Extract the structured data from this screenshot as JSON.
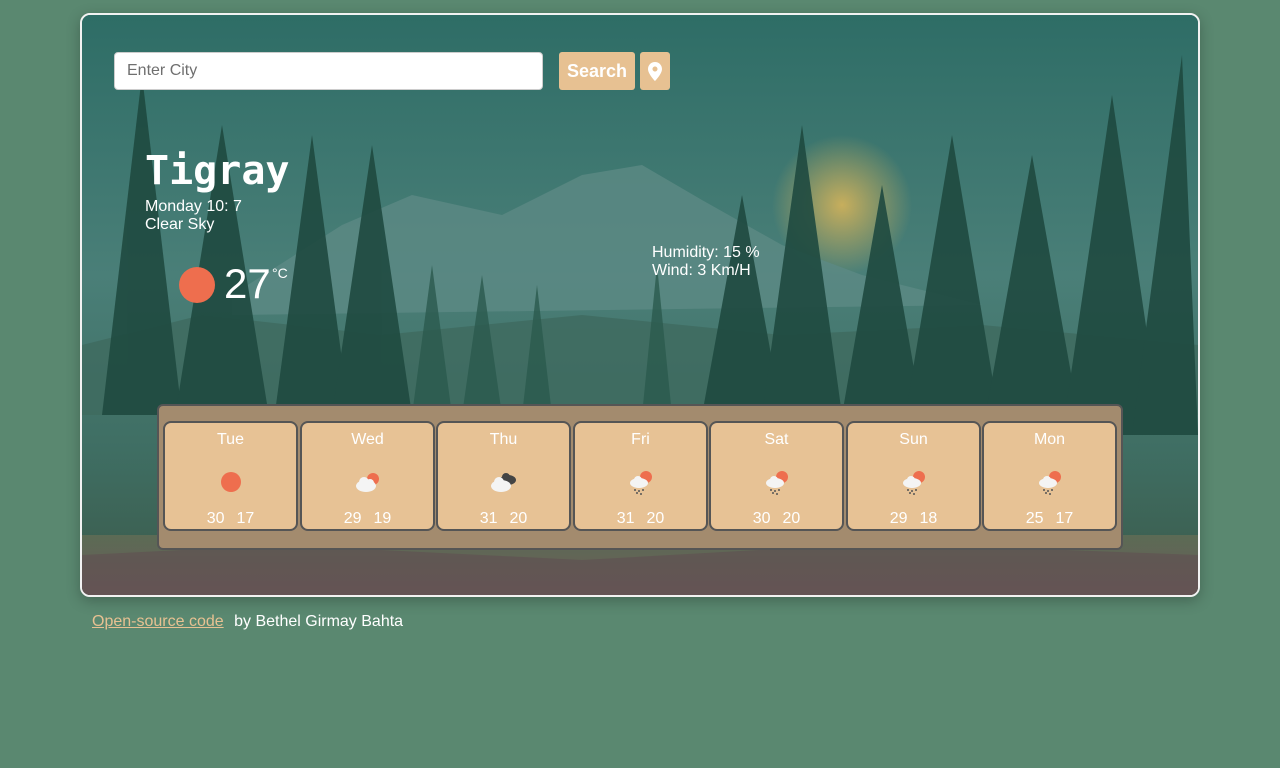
{
  "search": {
    "placeholder": "Enter City",
    "value": "",
    "button_label": "Search"
  },
  "current": {
    "city": "Tigray",
    "datetime": "Monday 10: 7",
    "description": "Clear Sky",
    "temperature": "27",
    "unit": "°C",
    "humidity": "Humidity: 15 %",
    "wind": "Wind: 3 Km/H",
    "icon": "clear-sky-icon"
  },
  "forecast": [
    {
      "day": "Tue",
      "high": "30",
      "low": "17",
      "icon": "clear-sky-icon"
    },
    {
      "day": "Wed",
      "high": "29",
      "low": "19",
      "icon": "few-clouds-icon"
    },
    {
      "day": "Thu",
      "high": "31",
      "low": "20",
      "icon": "broken-clouds-icon"
    },
    {
      "day": "Fri",
      "high": "31",
      "low": "20",
      "icon": "rain-icon"
    },
    {
      "day": "Sat",
      "high": "30",
      "low": "20",
      "icon": "rain-icon"
    },
    {
      "day": "Sun",
      "high": "29",
      "low": "18",
      "icon": "rain-icon"
    },
    {
      "day": "Mon",
      "high": "25",
      "low": "17",
      "icon": "rain-icon"
    }
  ],
  "footer": {
    "link_text": "Open-source code",
    "byline": "by Bethel Girmay Bahta"
  },
  "colors": {
    "page_background": "#5a8870",
    "accent": "#e7c192",
    "sun": "#ee6e4e",
    "forecast_panel": "#a38b6e"
  }
}
